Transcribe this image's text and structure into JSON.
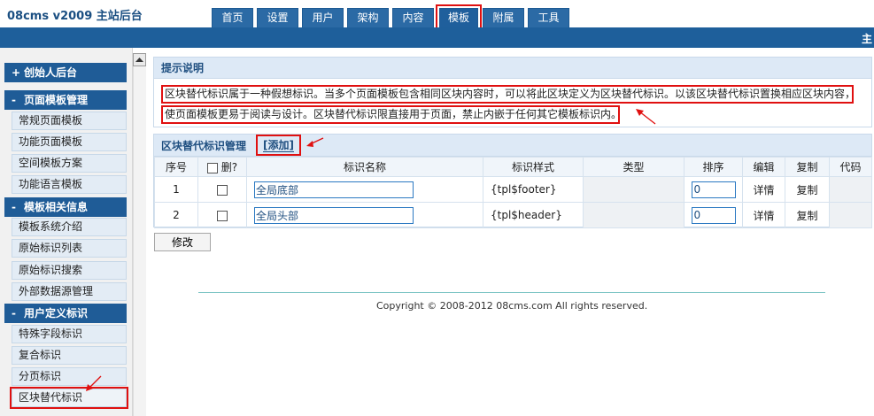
{
  "header": {
    "brand": "08cms  v2009  主站后台",
    "tabs": [
      {
        "label": "首页"
      },
      {
        "label": "设置"
      },
      {
        "label": "用户"
      },
      {
        "label": "架构"
      },
      {
        "label": "内容"
      },
      {
        "label": "模板"
      },
      {
        "label": "附属"
      },
      {
        "label": "工具"
      }
    ],
    "active_tab": "模板",
    "bar_text": "主"
  },
  "sidebar": {
    "founder": "创始人后台",
    "sections": [
      {
        "title": "页面模板管理",
        "items": [
          "常规页面模板",
          "功能页面模板",
          "空间模板方案",
          "功能语言模板"
        ]
      },
      {
        "title": "模板相关信息",
        "items": [
          "模板系统介绍",
          "原始标识列表",
          "原始标识搜索",
          "外部数据源管理"
        ]
      },
      {
        "title": "用户定义标识",
        "items": [
          "特殊字段标识",
          "复合标识",
          "分页标识",
          "区块替代标识"
        ]
      }
    ],
    "plus_symbol": "+",
    "minus_symbol": "-"
  },
  "tips": {
    "title": "提示说明",
    "line1": "区块替代标识属于一种假想标识。当多个页面模板包含相同区块内容时，可以将此区块定义为区块替代标识。以该区块替代标识置换相应区块内容，",
    "line2": "使页面模板更易于阅读与设计。区块替代标识限直接用于页面，禁止内嵌于任何其它模板标识内。"
  },
  "manage": {
    "title": "区块替代标识管理",
    "add_label": "[添加]",
    "columns": [
      "序号",
      "删?",
      "标识名称",
      "标识样式",
      "类型",
      "排序",
      "编辑",
      "复制",
      "代码"
    ],
    "rows": [
      {
        "index": "1",
        "name": "全局底部",
        "style": "{tpl$footer}",
        "type": "",
        "order": "0",
        "edit": "详情",
        "copy": "复制",
        "code": ""
      },
      {
        "index": "2",
        "name": "全局头部",
        "style": "{tpl$header}",
        "type": "",
        "order": "0",
        "edit": "详情",
        "copy": "复制",
        "code": ""
      }
    ]
  },
  "edit_button": "修改",
  "footer": {
    "copyright": "Copyright © 2008-2012 08cms.com All rights reserved."
  },
  "colors": {
    "accent_blue": "#1e5f9b",
    "highlight_red": "#e01010"
  }
}
